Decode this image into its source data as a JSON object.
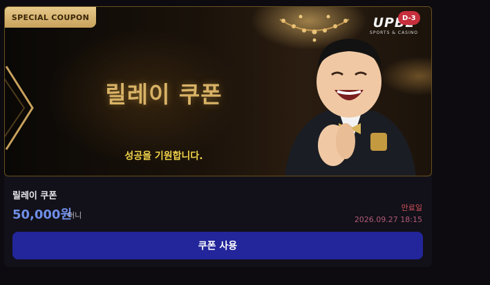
{
  "banner": {
    "badge": "SPECIAL COUPON",
    "headline": "릴레이 쿠폰",
    "subline": "성공을 기원합니다.",
    "logo_word": "UPBE",
    "logo_sub": "SPORTS & CASINO",
    "dday": "D-3"
  },
  "coupon": {
    "title": "릴레이 쿠폰",
    "amount": "50,000원",
    "unit": "머니",
    "expiry_label": "만료일",
    "expiry_date": "2026.09.27 18:15",
    "button_label": "쿠폰 사용"
  },
  "colors": {
    "accent_button": "#23259a",
    "amount_blue": "#6f8fe8",
    "gold": "#d8b266",
    "expiry_red": "#d4525c",
    "dday_red": "#c62f3c"
  }
}
